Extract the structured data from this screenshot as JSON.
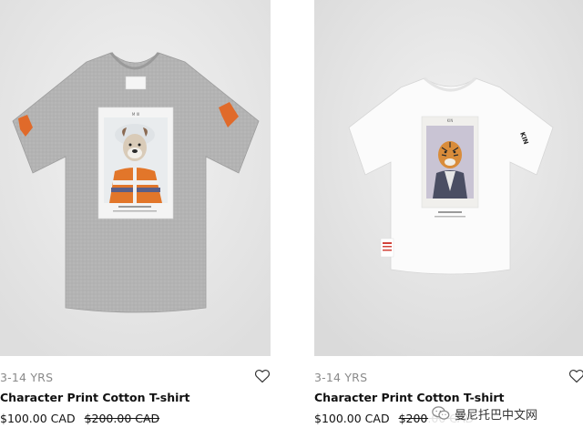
{
  "products": [
    {
      "age_range": "3-14 YRS",
      "name": "Character Print Cotton T-shirt",
      "price_current": "$100.00 CAD",
      "price_original": "$200.00 CAD",
      "image": {
        "shirt_color": "#b2b2b2",
        "print_character": "bulldog",
        "print_caption": "Bruno"
      }
    },
    {
      "age_range": "3-14 YRS",
      "name": "Character Print Cotton T-shirt",
      "price_current": "$100.00 CAD",
      "price_original": "$200.00 CAD",
      "image": {
        "shirt_color": "#ffffff",
        "print_character": "tiger",
        "sleeve_text": "KIN"
      }
    }
  ],
  "icons": {
    "favorite": "heart-outline-icon"
  },
  "watermark": {
    "text": "曼尼托巴中文网"
  }
}
